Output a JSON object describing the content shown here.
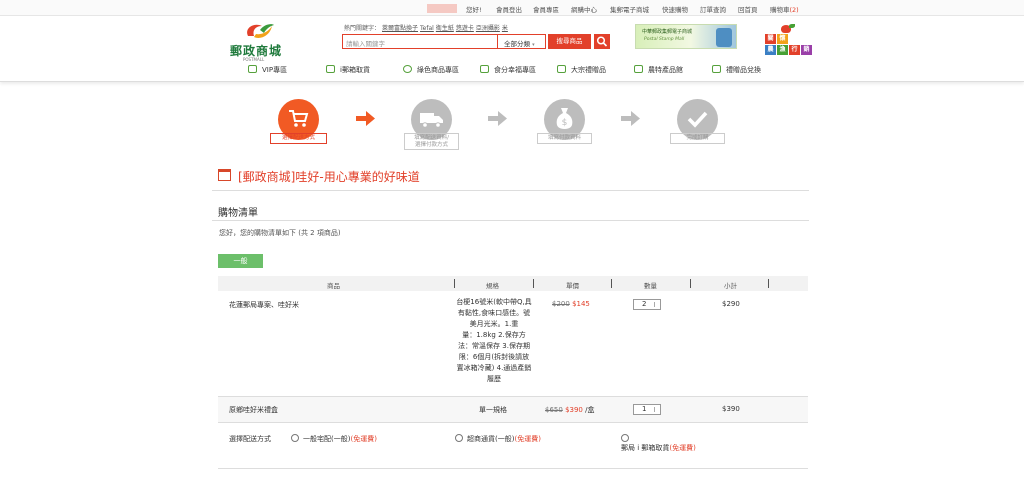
{
  "topbar": {
    "greeting": "您好!",
    "links": [
      "會員登出",
      "會員專區",
      "網購中心",
      "集郵電子商城",
      "快速購物",
      "訂單查詢",
      "回首頁"
    ],
    "cart_label": "購物車",
    "cart_count": "(2)"
  },
  "header": {
    "logo_text": "郵政商城",
    "logo_sub": "POSTMALL",
    "hot_label": "熱門關鍵字：",
    "hot_keywords": [
      "萊爾富點換子",
      "Tefal",
      "衛生紙",
      "悠遊卡",
      "亞洲攝影",
      "米"
    ],
    "search_placeholder": "請輸入關鍵字",
    "category_select": "全部分類",
    "search_button": "搜尋商品",
    "banner_title": "中華郵政集郵電子商城",
    "banner_slogan": "Postal Stamp Mall",
    "right_logo_chars": [
      "關",
      "懷",
      "農",
      "漁",
      "行",
      "銷"
    ]
  },
  "nav": [
    "VIP專區",
    "i郵箱取貨",
    "綠色商品專區",
    "食分幸福專區",
    "大宗禮贈品",
    "農特產品館",
    "禮贈品兌換"
  ],
  "steps": [
    {
      "label_lines": [
        "選擇配送方式"
      ],
      "icon": "cart-icon"
    },
    {
      "label_lines": [
        "填寫配送資料/",
        "選擇付款方式"
      ],
      "icon": "truck-icon"
    },
    {
      "label_lines": [
        "填寫付款資料"
      ],
      "icon": "money-bag-icon"
    },
    {
      "label_lines": [
        "完成訂購"
      ],
      "icon": "check-icon"
    }
  ],
  "store_title": "[郵政商城]哇好-用心專業的好味道",
  "cart_title": "購物清單",
  "greeting_line": "您好，您的購物清單如下 (共 2 項商品)",
  "group_tag": "一般",
  "table_headers": [
    "商品",
    "規格",
    "單價",
    "數量",
    "小計"
  ],
  "items": [
    {
      "name": "花蓮郵局專案、哇好米",
      "spec_lines": [
        "台梗16號米(軟中帶Q,具",
        "有黏性,食味口感佳。號",
        "美月光米。1.重",
        "量：1.8kg 2.保存方",
        "法：常溫保存 3.保存期",
        "限：6個月(拆封後請放",
        "置冰箱冷藏) 4.通過產銷",
        "履歷"
      ],
      "orig_price": "$200",
      "price": "$145",
      "qty": "2",
      "subtotal": "$290"
    },
    {
      "name": "原鄉哇好米禮盒",
      "spec": "單一規格",
      "orig_price": "$650",
      "price": "$390",
      "unit": "/盒",
      "qty": "1",
      "subtotal": "$390"
    }
  ],
  "delivery": {
    "label": "選擇配送方式",
    "options": [
      {
        "text": "一般宅配(一般)",
        "fee": "(免運費)"
      },
      {
        "text": "超商通貨(一般)",
        "fee": "(免運費)"
      },
      {
        "text": "郵局 i 郵箱取貨",
        "fee": "(免運費)"
      }
    ]
  },
  "colors": {
    "accent": "#e2402a",
    "step_active": "#f15a24",
    "step_inactive": "#bdbdbd",
    "green": "#6cbf6a"
  }
}
